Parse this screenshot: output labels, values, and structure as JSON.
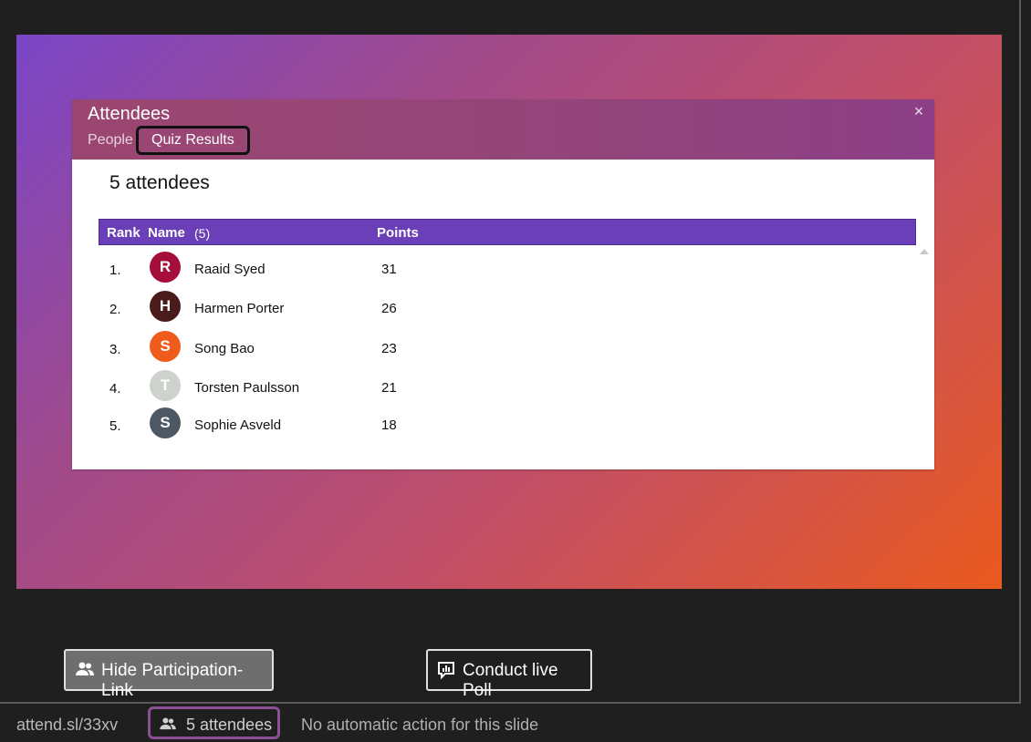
{
  "slide": {
    "panel": {
      "title": "Attendees",
      "close_glyph": "×",
      "tabs": [
        {
          "label": "People",
          "selected": false
        },
        {
          "label": "Quiz Results",
          "selected": true
        }
      ],
      "attendee_count_text": "5 attendees",
      "table": {
        "headers": {
          "rank": "Rank",
          "name": "Name",
          "name_count": "(5)",
          "points": "Points"
        },
        "rows": [
          {
            "rank": "1.",
            "initial": "R",
            "name": "Raaid Syed",
            "points": "31",
            "avatar_color": "#a50e3b"
          },
          {
            "rank": "2.",
            "initial": "H",
            "name": "Harmen Porter",
            "points": "26",
            "avatar_color": "#4a1b1b"
          },
          {
            "rank": "3.",
            "initial": "S",
            "name": "Song Bao",
            "points": "23",
            "avatar_color": "#f05a1c"
          },
          {
            "rank": "4.",
            "initial": "T",
            "name": "Torsten Paulsson",
            "points": "21",
            "avatar_color": "#cdd2cd"
          },
          {
            "rank": "5.",
            "initial": "S",
            "name": "Sophie Asveld",
            "points": "18",
            "avatar_color": "#4c5864"
          }
        ]
      }
    }
  },
  "buttons": {
    "hide_participation": {
      "label": "Hide Participation-Link",
      "icon": "people-icon"
    },
    "conduct_poll": {
      "label": "Conduct live Poll",
      "icon": "poll-icon"
    }
  },
  "status_bar": {
    "link": "attend.sl/33xv",
    "attendees": "5 attendees",
    "message": "No automatic action for this slide"
  },
  "colors": {
    "table_header": "#6a3fb8",
    "panel_header": "#93457a",
    "highlight_border": "#8a4f95"
  }
}
